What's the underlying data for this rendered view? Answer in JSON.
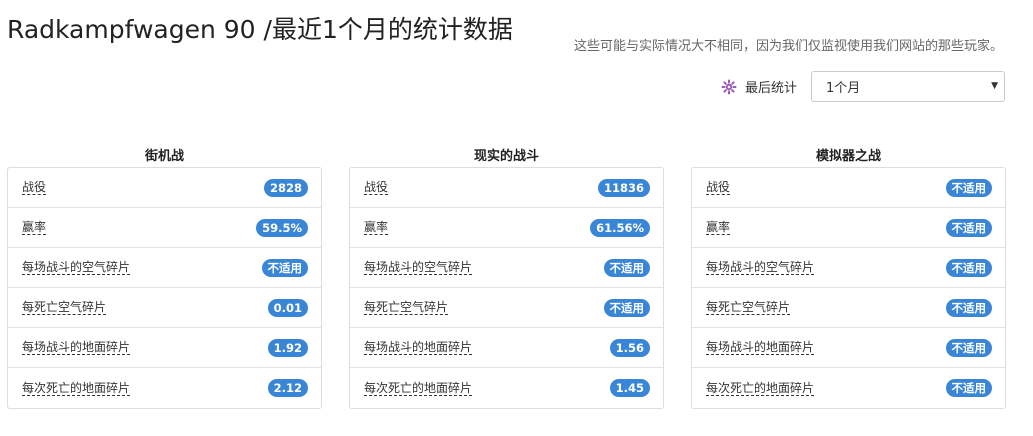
{
  "header": {
    "title": "Radkampfwagen 90 /最近1个月的统计数据",
    "disclaimer": "这些可能与实际情况大不相同，因为我们仅监视使用我们网站的那些玩家。"
  },
  "period": {
    "icon": "gear-icon",
    "label": "最后统计",
    "selected": "1个月"
  },
  "colors": {
    "badge": "#3a86d6",
    "icon": "#9b59b6"
  },
  "panels": [
    {
      "title": "街机战",
      "rows": [
        {
          "label": "战役",
          "value": "2828"
        },
        {
          "label": "赢率",
          "value": "59.5%"
        },
        {
          "label": "每场战斗的空气碎片",
          "value": "不适用"
        },
        {
          "label": "每死亡空气碎片",
          "value": "0.01"
        },
        {
          "label": "每场战斗的地面碎片",
          "value": "1.92"
        },
        {
          "label": "每次死亡的地面碎片",
          "value": "2.12"
        }
      ]
    },
    {
      "title": "现实的战斗",
      "rows": [
        {
          "label": "战役",
          "value": "11836"
        },
        {
          "label": "赢率",
          "value": "61.56%"
        },
        {
          "label": "每场战斗的空气碎片",
          "value": "不适用"
        },
        {
          "label": "每死亡空气碎片",
          "value": "不适用"
        },
        {
          "label": "每场战斗的地面碎片",
          "value": "1.56"
        },
        {
          "label": "每次死亡的地面碎片",
          "value": "1.45"
        }
      ]
    },
    {
      "title": "模拟器之战",
      "rows": [
        {
          "label": "战役",
          "value": "不适用"
        },
        {
          "label": "赢率",
          "value": "不适用"
        },
        {
          "label": "每场战斗的空气碎片",
          "value": "不适用"
        },
        {
          "label": "每死亡空气碎片",
          "value": "不适用"
        },
        {
          "label": "每场战斗的地面碎片",
          "value": "不适用"
        },
        {
          "label": "每次死亡的地面碎片",
          "value": "不适用"
        }
      ]
    }
  ]
}
